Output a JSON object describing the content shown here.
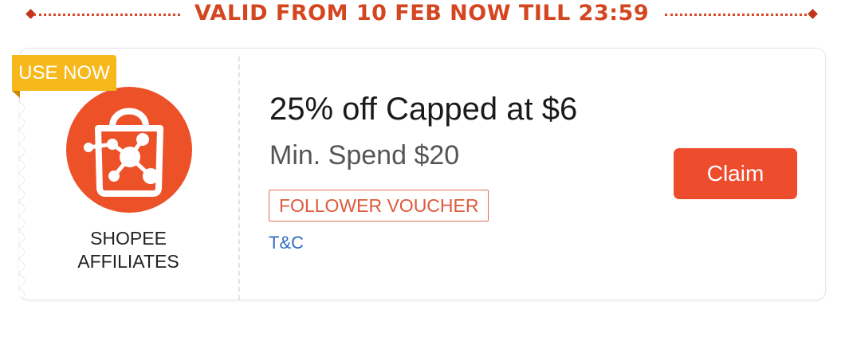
{
  "banner": {
    "validity_text": "VALID FROM 10 FEB NOW TILL 23:59",
    "accent_color": "#d4461f"
  },
  "voucher": {
    "ribbon_label": "USE NOW",
    "ribbon_color": "#f6b81a",
    "logo_icon": "shopee-affiliates-bag-icon",
    "logo_color": "#ed5128",
    "brand_line1": "SHOPEE",
    "brand_line2": "AFFILIATES",
    "title": "25% off Capped at $6",
    "min_spend": "Min. Spend $20",
    "tag": "FOLLOWER VOUCHER",
    "terms_link": "T&C",
    "claim_label": "Claim",
    "claim_color": "#ee4d2d"
  }
}
